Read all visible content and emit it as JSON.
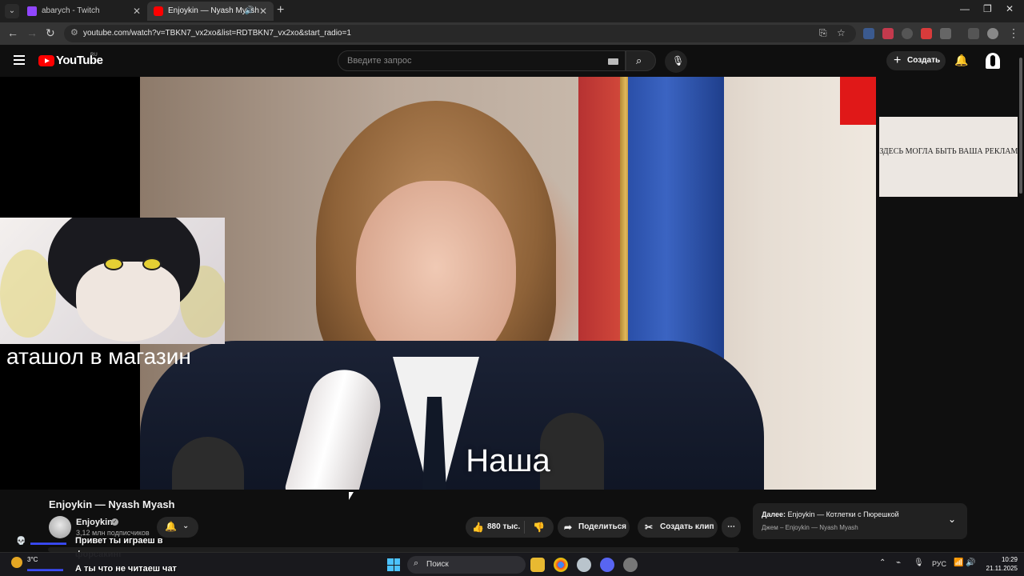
{
  "browser": {
    "tabs": [
      {
        "title": "abarych - Twitch",
        "active": false
      },
      {
        "title": "Enjoykin — Nyash Myash -",
        "active": true
      }
    ],
    "url": "youtube.com/watch?v=TBKN7_vx2xo&list=RDTBKN7_vx2xo&start_radio=1"
  },
  "youtube": {
    "logo_text": "YouTube",
    "region": "RU",
    "search_placeholder": "Введите запрос",
    "create_label": "Создать"
  },
  "video": {
    "subtitle": "Наша",
    "overlay_text": "аташол в магазин",
    "ad_text": "ЗДЕСЬ МОГЛА БЫТЬ ВАША РЕКЛАМА"
  },
  "info": {
    "title": "Enjoykin — Nyash Myash",
    "channel": "Enjoykin",
    "subscribers": "3,12 млн подписчиков",
    "likes": "880 тыс.",
    "share_label": "Поделиться",
    "clip_label": "Создать клип",
    "next_prefix": "Далее:",
    "next_title": "Enjoykin — Котлетки с Пюрешкой",
    "next_sub": "Джем – Enjoykin — Nyash Myash"
  },
  "chat": {
    "messages": [
      "Привет ты играеш в",
      "форсакинг",
      "А ты что не читаеш чат"
    ]
  },
  "taskbar": {
    "temp": "3°C",
    "search_label": "Поиск",
    "lang": "РУС",
    "time": "10:29",
    "date": "21.11.2025"
  },
  "colors": {
    "youtube_red": "#ff0000",
    "background": "#0f0f0f",
    "twitch_purple": "#9146ff"
  }
}
